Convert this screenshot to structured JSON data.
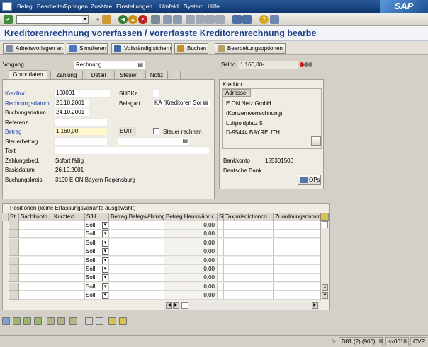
{
  "menu": [
    "Beleg",
    "Bearbeiten",
    "Springen",
    "Zusätze",
    "Einstellungen",
    "Umfeld",
    "System",
    "Hilfe"
  ],
  "logo": "SAP",
  "title": "Kreditorenrechnung vorerfassen / vorerfasste Kreditorenrechnung bearbe",
  "toolbar": {
    "arbeitsvorlagen": "Arbeitsvorlagen an",
    "simulieren": "Simulieren",
    "sichern": "Vollständig sichern",
    "buchen": "Buchen",
    "optionen": "Bearbeitungsoptionen"
  },
  "vorgang": {
    "label": "Vorgang",
    "value": "Rechnung"
  },
  "saldo": {
    "label": "Saldo",
    "value": "1.160,00-"
  },
  "tabs": [
    "Grunddaten",
    "Zahlung",
    "Detail",
    "Steuer",
    "Notiz"
  ],
  "grunddaten": {
    "kreditor_label": "Kreditor",
    "kreditor": "100001",
    "shbkz_label": "SHBKz",
    "rechnungsdatum_label": "Rechnungsdatum",
    "rechnungsdatum": "26.10.2001",
    "belegart_label": "Belegart",
    "belegart": "KA (Kreditoren Sor",
    "buchungsdatum_label": "Buchungsdatum",
    "buchungsdatum": "24.10.2001",
    "referenz_label": "Referenz",
    "betrag_label": "Betrag",
    "betrag": "1.160,00",
    "waehrung": "EUR",
    "steuer_rechnen": "Steuer rechnen",
    "steuerbetrag_label": "Steuerbetrag",
    "text_label": "Text",
    "zahlungsbed_label": "Zahlungsbed.",
    "zahlungsbed": "Sofort fällig",
    "basisdatum_label": "Basisdatum",
    "basisdatum": "26.10.2001",
    "buchungskreis_label": "Buchungskreis",
    "buchungskreis": "3190 E.ON Bayern Regensburg"
  },
  "kreditor_panel": {
    "title": "Kreditor",
    "adresse_label": "Adresse",
    "address": [
      "E.ON Netz GmbH",
      "(Konzernverrechnung)",
      "Luitpoldplatz 5",
      "D-95444 BAYREUTH"
    ],
    "bankkonto_label": "Bankkonto",
    "bankkonto": "155301500",
    "bank": "Deutsche Bank",
    "ops_button": "OPs"
  },
  "positions": {
    "title": "Positionen (keine Erfassungsvariante ausgewählt)",
    "columns": [
      "St..",
      "Sachkonto",
      "Kurztext",
      "S/H",
      "Betrag Belegwährung",
      "Betrag Hauswähru..",
      "S.",
      "Taxjurisdictionco...",
      "Zuordnungsnumm"
    ],
    "rows": [
      {
        "sh": "Soll",
        "betrag_hw": "0,00"
      },
      {
        "sh": "Soll",
        "betrag_hw": "0,00"
      },
      {
        "sh": "Soll",
        "betrag_hw": "0,00"
      },
      {
        "sh": "Soll",
        "betrag_hw": "0,00"
      },
      {
        "sh": "Soll",
        "betrag_hw": "0,00"
      },
      {
        "sh": "Soll",
        "betrag_hw": "0,00"
      },
      {
        "sh": "Soll",
        "betrag_hw": "0,00"
      },
      {
        "sh": "Soll",
        "betrag_hw": "0,00"
      },
      {
        "sh": "Soll",
        "betrag_hw": "0,00"
      }
    ]
  },
  "status": {
    "system": "D81 (2) (900)",
    "server": "sx0010",
    "mode": "OVR"
  },
  "colors": {
    "menu_bg": "#10366e",
    "title": "#1d3f85",
    "required": "#fff8cc"
  }
}
